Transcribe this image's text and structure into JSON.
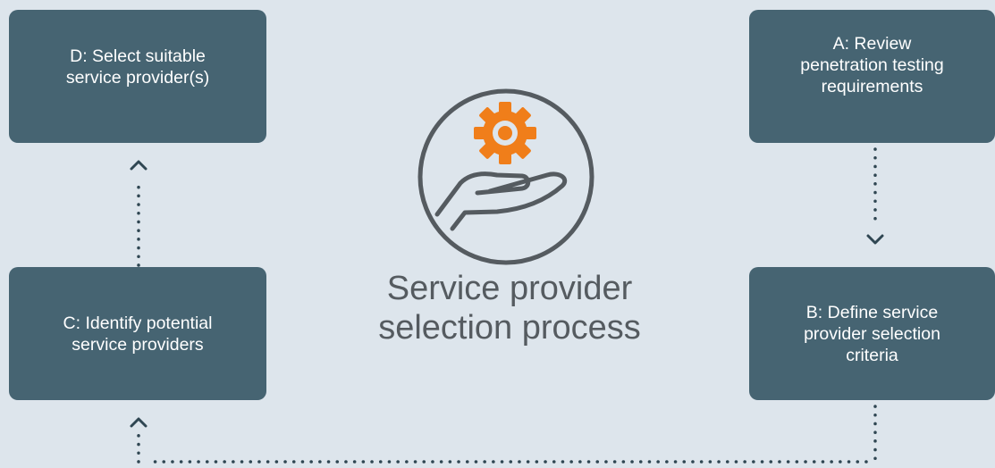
{
  "diagram": {
    "title": "Service provider\nselection process",
    "steps": [
      {
        "id": "A",
        "label": "A: Review\npenetration testing\nrequirements"
      },
      {
        "id": "B",
        "label": "B: Define service\nprovider selection\ncriteria"
      },
      {
        "id": "C",
        "label": "C: Identify potential\nservice providers"
      },
      {
        "id": "D",
        "label": "D: Select suitable\nservice provider(s)"
      }
    ],
    "icon": "hand-holding-gear-icon"
  },
  "colors": {
    "background": "#dde5ec",
    "box": "#466472",
    "box_text": "#ffffff",
    "title_text": "#555b60",
    "icon_outline": "#555b60",
    "gear": "#f07e1a",
    "connector": "#2f4652"
  }
}
